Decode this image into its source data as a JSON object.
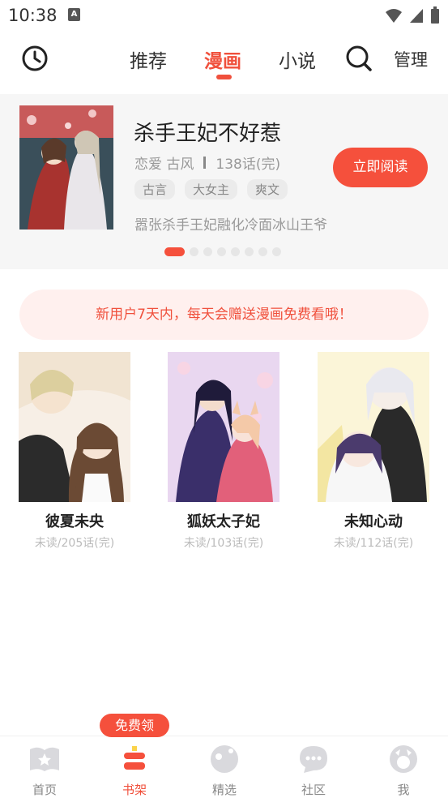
{
  "status_bar": {
    "time": "10:38",
    "notification_icon": "a-icon"
  },
  "top_nav": {
    "tabs": [
      {
        "label": "推荐",
        "active": false
      },
      {
        "label": "漫画",
        "active": true
      },
      {
        "label": "小说",
        "active": false
      }
    ],
    "manage_label": "管理"
  },
  "banner": {
    "title": "杀手王妃不好惹",
    "genre": "恋爱 古风",
    "chapters": "138话(完)",
    "tags": [
      "古言",
      "大女主",
      "爽文"
    ],
    "description": "嚣张杀手王妃融化冷面冰山王爷",
    "read_button": "立即阅读",
    "page_count": 8,
    "active_page": 1
  },
  "promo_text": "新用户7天内，每天会赠送漫画免费看哦！",
  "books": [
    {
      "name": "彼夏未央",
      "status": "未读/205话(完)"
    },
    {
      "name": "狐妖太子妃",
      "status": "未读/103话(完)"
    },
    {
      "name": "未知心动",
      "status": "未读/112话(完)"
    }
  ],
  "bottom_nav": {
    "badge": "免费领",
    "items": [
      {
        "label": "首页",
        "icon": "book-star-icon",
        "active": false
      },
      {
        "label": "书架",
        "icon": "bookshelf-icon",
        "active": true
      },
      {
        "label": "精选",
        "icon": "planet-icon",
        "active": false
      },
      {
        "label": "社区",
        "icon": "chat-bubble-icon",
        "active": false
      },
      {
        "label": "我",
        "icon": "profile-icon",
        "active": false
      }
    ]
  },
  "colors": {
    "accent": "#f5503c",
    "promo_bg": "#fff0ee",
    "banner_bg": "#f6f6f6"
  }
}
